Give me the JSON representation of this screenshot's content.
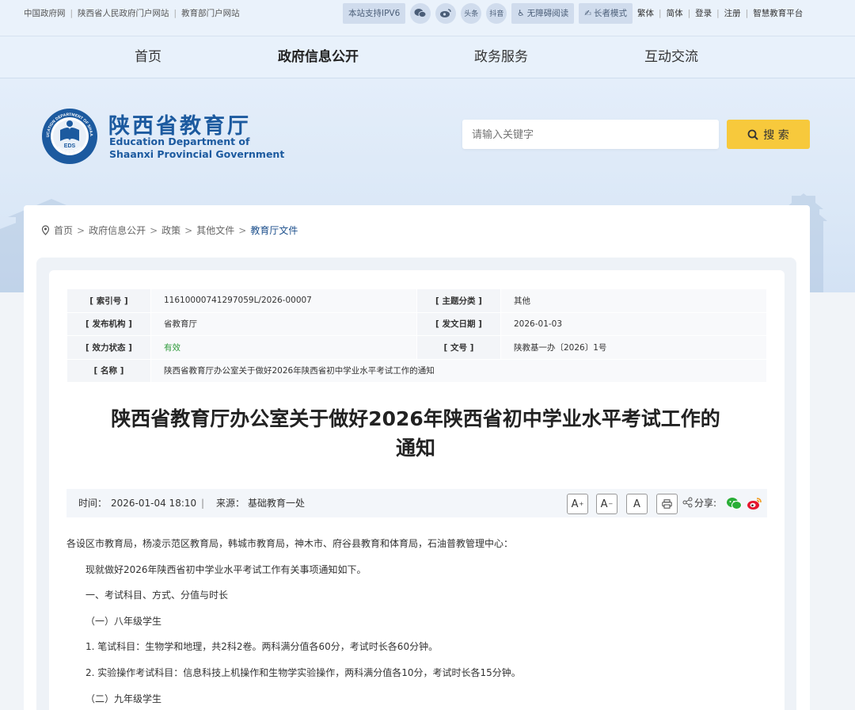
{
  "topbar": {
    "links": [
      "中国政府网",
      "陕西省人民政府门户网站",
      "教育部门户网站"
    ],
    "ipv6": "本站支持IPV6",
    "social_icons": [
      "wechat-icon",
      "weibo-icon",
      "toutiao-icon",
      "douyin-icon"
    ],
    "social_labels": [
      "头条",
      "抖音"
    ],
    "accessible": "无障碍阅读",
    "elder": "长者模式",
    "right_links": [
      "繁体",
      "简体",
      "登录",
      "注册",
      "智慧教育平台"
    ]
  },
  "nav": {
    "items": [
      "首页",
      "政府信息公开",
      "政务服务",
      "互动交流"
    ],
    "active_index": 1
  },
  "header": {
    "emblem_ring": "EDUCATION DEPARTMENT OF SHAANXI",
    "emblem_center": "EDS",
    "emblem_bottom": "陕西省教育厅",
    "name_cn": "陕西省教育厅",
    "name_en_1": "Education Department of",
    "name_en_2": "Shaanxi Provincial Government",
    "search_placeholder": "请输入关键字",
    "search_button": "搜 索"
  },
  "breadcrumb": [
    "首页",
    "政府信息公开",
    "政策",
    "其他文件",
    "教育厅文件"
  ],
  "meta": {
    "index_label": "[ 索引号 ]",
    "index_value": "11610000741297059L/2026-00007",
    "topic_label": "[ 主题分类 ]",
    "topic_value": "其他",
    "publisher_label": "[ 发布机构 ]",
    "publisher_value": "省教育厅",
    "date_label": "[ 发文日期 ]",
    "date_value": "2026-01-03",
    "status_label": "[ 效力状态 ]",
    "status_value": "有效",
    "docno_label": "[ 文号 ]",
    "docno_value": "陕教基一办〔2026〕1号",
    "name_label": "[ 名称 ]",
    "name_value": "陕西省教育厅办公室关于做好2026年陕西省初中学业水平考试工作的通知"
  },
  "article": {
    "title_line1": "陕西省教育厅办公室关于做好2026年陕西省初中学业水平考试工作的",
    "title_line2": "通知",
    "time_label": "时间：",
    "time_value": "2026-01-04 18:10",
    "divider": "|",
    "source_label": "来源：",
    "source_value": "基础教育一处",
    "font_large": "A",
    "font_small": "A",
    "font_reset": "A",
    "share_label": "分享:",
    "paragraphs": [
      "各设区市教育局，杨凌示范区教育局，韩城市教育局，神木市、府谷县教育和体育局，石油普教管理中心：",
      "现就做好2026年陕西省初中学业水平考试工作有关事项通知如下。",
      "一、考试科目、方式、分值与时长",
      "（一）八年级学生",
      "1. 笔试科目：生物学和地理，共2科2卷。两科满分值各60分，考试时长各60分钟。",
      "2. 实验操作考试科目：信息科技上机操作和生物学实验操作，两科满分值各10分，考试时长各15分钟。",
      "（二）九年级学生"
    ]
  }
}
